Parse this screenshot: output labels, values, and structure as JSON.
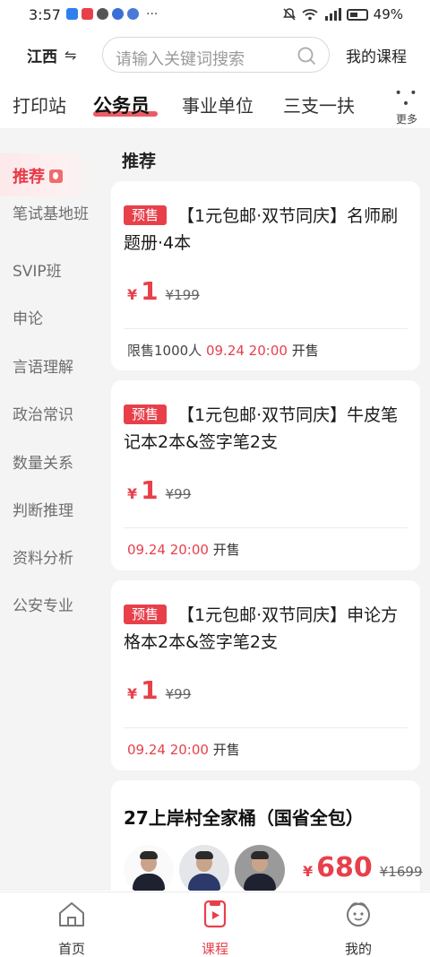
{
  "status_bar": {
    "time": "3:57",
    "more": "···",
    "signal": "⁴⁶",
    "battery": "49%"
  },
  "header": {
    "region": "江西",
    "region_switch": "⇋",
    "search_placeholder": "请输入关键词搜索",
    "my_course": "我的课程"
  },
  "categories": {
    "tabs": [
      "打印站",
      "公务员",
      "事业单位",
      "三支一扶"
    ],
    "active_index": 1,
    "more_dots": "• • •",
    "more_label": "更多"
  },
  "sidebar": {
    "active_label": "推荐",
    "items": [
      "笔试基地班",
      "SVIP班",
      "申论",
      "言语理解",
      "政治常识",
      "数量关系",
      "判断推理",
      "资料分析",
      "公安专业"
    ]
  },
  "section_title": "推荐",
  "cards": [
    {
      "badge": "预售",
      "title": "【1元包邮·双节同庆】名师刷题册·4本",
      "currency": "¥",
      "price": "1",
      "original_price": "¥199",
      "limit": "限售1000人",
      "sale_time": "09.24 20:00",
      "sale_suffix": "开售"
    },
    {
      "badge": "预售",
      "title": "【1元包邮·双节同庆】牛皮笔记本2本&签字笔2支",
      "currency": "¥",
      "price": "1",
      "original_price": "¥99",
      "sale_time": "09.24 20:00",
      "sale_suffix": "开售"
    },
    {
      "badge": "预售",
      "title": "【1元包邮·双节同庆】申论方格本2本&签字笔2支",
      "currency": "¥",
      "price": "1",
      "original_price": "¥99",
      "sale_time": "09.24 20:00",
      "sale_suffix": "开售"
    }
  ],
  "bundle": {
    "title": "27上岸村全家桶（国省全包）",
    "currency": "¥",
    "price": "680",
    "original_price": "¥1699"
  },
  "bottom_nav": {
    "items": [
      "首页",
      "课程",
      "我的"
    ],
    "active_index": 1
  },
  "colors": {
    "accent": "#e8404b",
    "background": "#f4f4f4"
  }
}
